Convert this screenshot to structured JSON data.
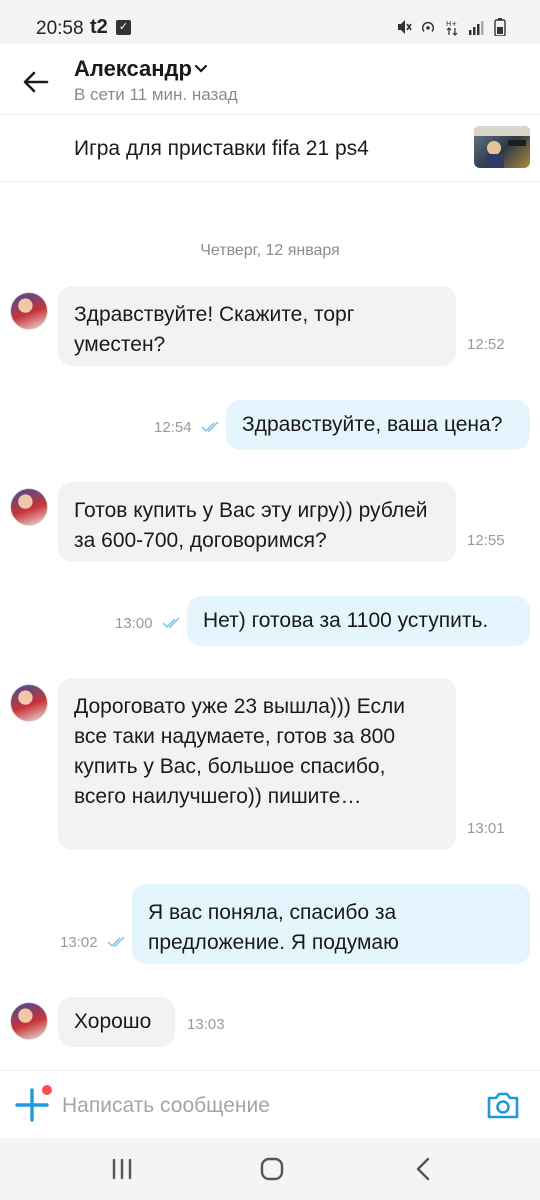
{
  "status_bar": {
    "time": "20:58",
    "carrier": "t2",
    "icons": [
      "mute-icon",
      "hotspot-icon",
      "data-icon",
      "signal-icon",
      "battery-icon"
    ]
  },
  "header": {
    "contact_name": "Александр",
    "status": "В сети 11 мин. назад"
  },
  "listing": {
    "title": "Игра для приставки fifa 21 ps4"
  },
  "chat": {
    "date_separator": "Четверг, 12 января",
    "messages": [
      {
        "direction": "in",
        "text": "Здравствуйте! Скажите, торг уместен?",
        "time": "12:52"
      },
      {
        "direction": "out",
        "text": "Здравствуйте, ваша цена?",
        "time": "12:54",
        "read": true
      },
      {
        "direction": "in",
        "text": "Готов купить у Вас эту игру)) рублей за 600-700, договоримся?",
        "time": "12:55"
      },
      {
        "direction": "out",
        "text": "Нет) готова за 1100 уступить.",
        "time": "13:00",
        "read": true
      },
      {
        "direction": "in",
        "text": "Дороговато уже 23 вышла))) Если все таки надумаете, готов за 800 купить у Вас, большое спасибо, всего наилучшего)) пишите…",
        "time": "13:01"
      },
      {
        "direction": "out",
        "text": "Я вас поняла, спасибо за предложение. Я подумаю",
        "time": "13:02",
        "read": true
      },
      {
        "direction": "in",
        "text": "Хорошо",
        "time": "13:03"
      }
    ]
  },
  "composer": {
    "placeholder": "Написать сообщение"
  },
  "colors": {
    "incoming_bubble": "#f2f2f2",
    "outgoing_bubble": "#e5f5fd",
    "accent": "#1e9bd7",
    "notification_dot": "#ff4b4b"
  }
}
